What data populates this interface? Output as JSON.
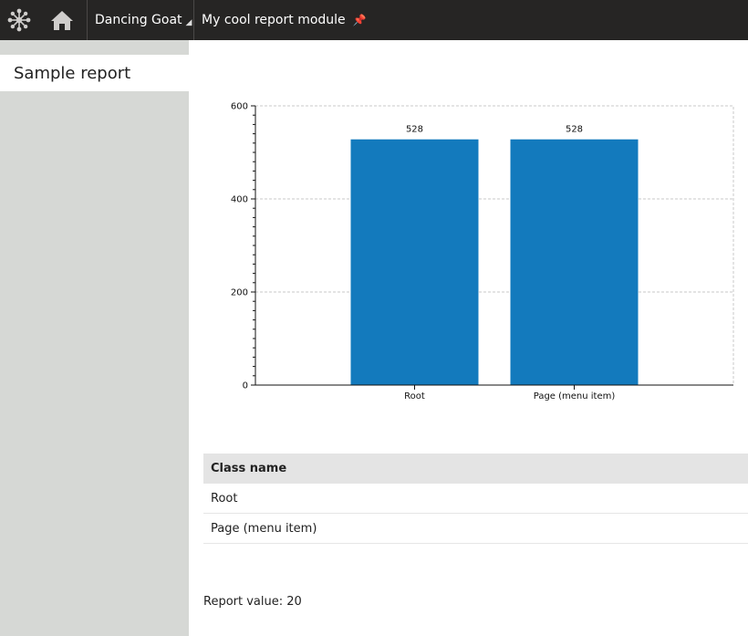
{
  "topbar": {
    "logo_icon": "kentico-logo-icon",
    "home_icon": "home-icon",
    "site_label": "Dancing Goat",
    "module_label": "My cool report module",
    "pin_icon": "pin-icon"
  },
  "sidebar": {
    "items": [
      {
        "label": "Sample report",
        "selected": true
      }
    ]
  },
  "chart_data": {
    "type": "bar",
    "categories": [
      "Root",
      "Page (menu item)"
    ],
    "values": [
      528,
      528
    ],
    "data_labels": [
      "528",
      "528"
    ],
    "title": "",
    "xlabel": "",
    "ylabel": "",
    "ylim": [
      0,
      600
    ],
    "yticks": [
      0,
      200,
      400,
      600
    ],
    "grid": true,
    "bar_color": "#137ABD"
  },
  "table": {
    "header": "Class name",
    "rows": [
      "Root",
      "Page (menu item)"
    ]
  },
  "report_value": "Report value: 20"
}
